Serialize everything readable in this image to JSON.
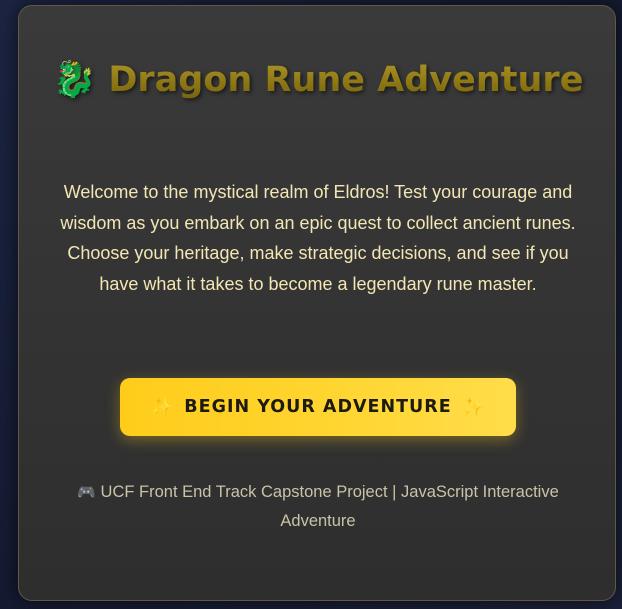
{
  "game": {
    "title_icon": "🐉",
    "title": "Dragon Rune Adventure",
    "description": "Welcome to the mystical realm of Eldros! Test your courage and wisdom as you embark on an epic quest to collect ancient runes. Choose your heritage, make strategic decisions, and see if you have what it takes to become a legendary rune master.",
    "start_button": {
      "icon_left": "✨",
      "label": "BEGIN YOUR ADVENTURE",
      "icon_right": "✨"
    },
    "footer": {
      "icon": "🎮",
      "text": "UCF Front End Track Capstone Project | JavaScript Interactive Adventure"
    }
  },
  "icons": {
    "title": "dragon-icon",
    "button": "sparkles-icon",
    "footer": "game-controller-icon"
  },
  "colors": {
    "title_gold": "#8a7412",
    "description_text": "#f3e6b4",
    "button_yellow": "#ffd633",
    "button_text": "#1d1a10",
    "footer_text": "#c9c3a8",
    "card_bg": "#363636",
    "page_bg": "#1a2038"
  }
}
